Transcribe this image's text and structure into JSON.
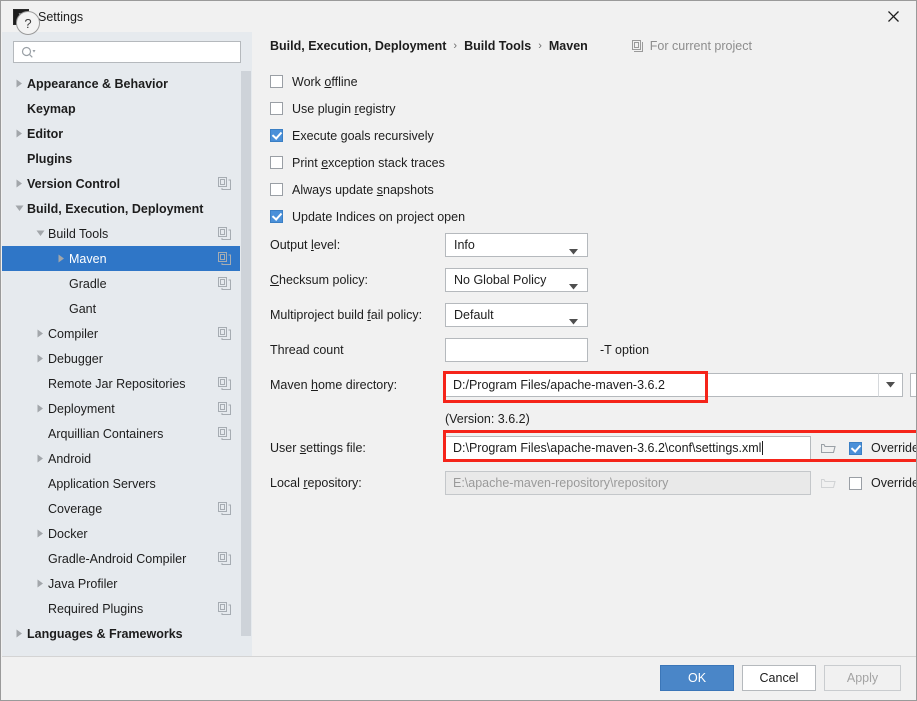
{
  "window": {
    "title": "Settings",
    "app_icon": "intellij-idea-icon",
    "close_icon": "close-icon"
  },
  "sidebar": {
    "search": {
      "placeholder": "",
      "value": "",
      "icon": "search-icon"
    },
    "items": [
      {
        "label": "Appearance & Behavior",
        "indent": 0,
        "arrow": "collapsed",
        "bold": true,
        "badge": false,
        "selected": false
      },
      {
        "label": "Keymap",
        "indent": 0,
        "arrow": "none",
        "bold": true,
        "badge": false,
        "selected": false
      },
      {
        "label": "Editor",
        "indent": 0,
        "arrow": "collapsed",
        "bold": true,
        "badge": false,
        "selected": false
      },
      {
        "label": "Plugins",
        "indent": 0,
        "arrow": "none",
        "bold": true,
        "badge": false,
        "selected": false
      },
      {
        "label": "Version Control",
        "indent": 0,
        "arrow": "collapsed",
        "bold": true,
        "badge": true,
        "selected": false
      },
      {
        "label": "Build, Execution, Deployment",
        "indent": 0,
        "arrow": "expanded",
        "bold": true,
        "badge": false,
        "selected": false
      },
      {
        "label": "Build Tools",
        "indent": 1,
        "arrow": "expanded",
        "bold": false,
        "badge": true,
        "selected": false
      },
      {
        "label": "Maven",
        "indent": 2,
        "arrow": "collapsed",
        "bold": false,
        "badge": true,
        "selected": true
      },
      {
        "label": "Gradle",
        "indent": 2,
        "arrow": "none",
        "bold": false,
        "badge": true,
        "selected": false
      },
      {
        "label": "Gant",
        "indent": 2,
        "arrow": "none",
        "bold": false,
        "badge": false,
        "selected": false
      },
      {
        "label": "Compiler",
        "indent": 1,
        "arrow": "collapsed",
        "bold": false,
        "badge": true,
        "selected": false
      },
      {
        "label": "Debugger",
        "indent": 1,
        "arrow": "collapsed",
        "bold": false,
        "badge": false,
        "selected": false
      },
      {
        "label": "Remote Jar Repositories",
        "indent": 1,
        "arrow": "none",
        "bold": false,
        "badge": true,
        "selected": false
      },
      {
        "label": "Deployment",
        "indent": 1,
        "arrow": "collapsed",
        "bold": false,
        "badge": true,
        "selected": false
      },
      {
        "label": "Arquillian Containers",
        "indent": 1,
        "arrow": "none",
        "bold": false,
        "badge": true,
        "selected": false
      },
      {
        "label": "Android",
        "indent": 1,
        "arrow": "collapsed",
        "bold": false,
        "badge": false,
        "selected": false
      },
      {
        "label": "Application Servers",
        "indent": 1,
        "arrow": "none",
        "bold": false,
        "badge": false,
        "selected": false
      },
      {
        "label": "Coverage",
        "indent": 1,
        "arrow": "none",
        "bold": false,
        "badge": true,
        "selected": false
      },
      {
        "label": "Docker",
        "indent": 1,
        "arrow": "collapsed",
        "bold": false,
        "badge": false,
        "selected": false
      },
      {
        "label": "Gradle-Android Compiler",
        "indent": 1,
        "arrow": "none",
        "bold": false,
        "badge": true,
        "selected": false
      },
      {
        "label": "Java Profiler",
        "indent": 1,
        "arrow": "collapsed",
        "bold": false,
        "badge": false,
        "selected": false
      },
      {
        "label": "Required Plugins",
        "indent": 1,
        "arrow": "none",
        "bold": false,
        "badge": true,
        "selected": false
      },
      {
        "label": "Languages & Frameworks",
        "indent": 0,
        "arrow": "collapsed",
        "bold": true,
        "badge": false,
        "selected": false
      }
    ]
  },
  "breadcrumb": {
    "parts": [
      "Build, Execution, Deployment",
      "Build Tools",
      "Maven"
    ],
    "separator": "›",
    "scope_label": "For current project",
    "scope_icon": "project-scope-icon"
  },
  "options": [
    {
      "label_pre": "Work ",
      "mnemonic": "o",
      "label_post": "ffline",
      "checked": false
    },
    {
      "label_pre": "Use plugin ",
      "mnemonic": "r",
      "label_post": "egistry",
      "checked": false
    },
    {
      "label_pre": "Execute ",
      "mnemonic": "g",
      "label_post": "oals recursively",
      "checked": true
    },
    {
      "label_pre": "Print ",
      "mnemonic": "e",
      "label_post": "xception stack traces",
      "checked": false
    },
    {
      "label_pre": "Always update ",
      "mnemonic": "s",
      "label_post": "napshots",
      "checked": false
    },
    {
      "label_pre": "Update Indices on project open",
      "mnemonic": "",
      "label_post": "",
      "checked": true
    }
  ],
  "fields": {
    "output_level": {
      "label_pre": "Output ",
      "mnemonic": "l",
      "label_post": "evel:",
      "value": "Info"
    },
    "checksum_policy": {
      "label_pre": "",
      "mnemonic": "C",
      "label_post": "hecksum policy:",
      "value": "No Global Policy"
    },
    "fail_policy": {
      "label_pre": "Multiproject build ",
      "mnemonic": "f",
      "label_post": "ail policy:",
      "value": "Default"
    },
    "thread_count": {
      "label_pre": "Thread count",
      "mnemonic": "",
      "label_post": "",
      "value": "",
      "note": "-T option"
    },
    "maven_home": {
      "label_pre": "Maven ",
      "mnemonic": "h",
      "label_post": "ome directory:",
      "value": "D:/Program Files/apache-maven-3.6.2",
      "version_note": "(Version: 3.6.2)"
    },
    "user_settings": {
      "label_pre": "User ",
      "mnemonic": "s",
      "label_post": "ettings file:",
      "value": "D:\\Program Files\\apache-maven-3.6.2\\conf\\settings.xml",
      "override_label": "Override",
      "override_checked": true
    },
    "local_repo": {
      "label_pre": "Local ",
      "mnemonic": "r",
      "label_post": "epository:",
      "value": "E:\\apache-maven-repository\\repository",
      "override_label": "Override",
      "override_checked": false
    }
  },
  "footer": {
    "help_label": "?",
    "ok_label": "OK",
    "cancel_label": "Cancel",
    "apply_label": "Apply"
  },
  "colors": {
    "selection_blue": "#2f76c7",
    "accent_button": "#4a86c8",
    "checkbox_blue": "#4a90d9",
    "highlight_red": "#f5241a",
    "sidebar_bg": "#e6eaee",
    "panel_bg": "#f1f1f1"
  }
}
